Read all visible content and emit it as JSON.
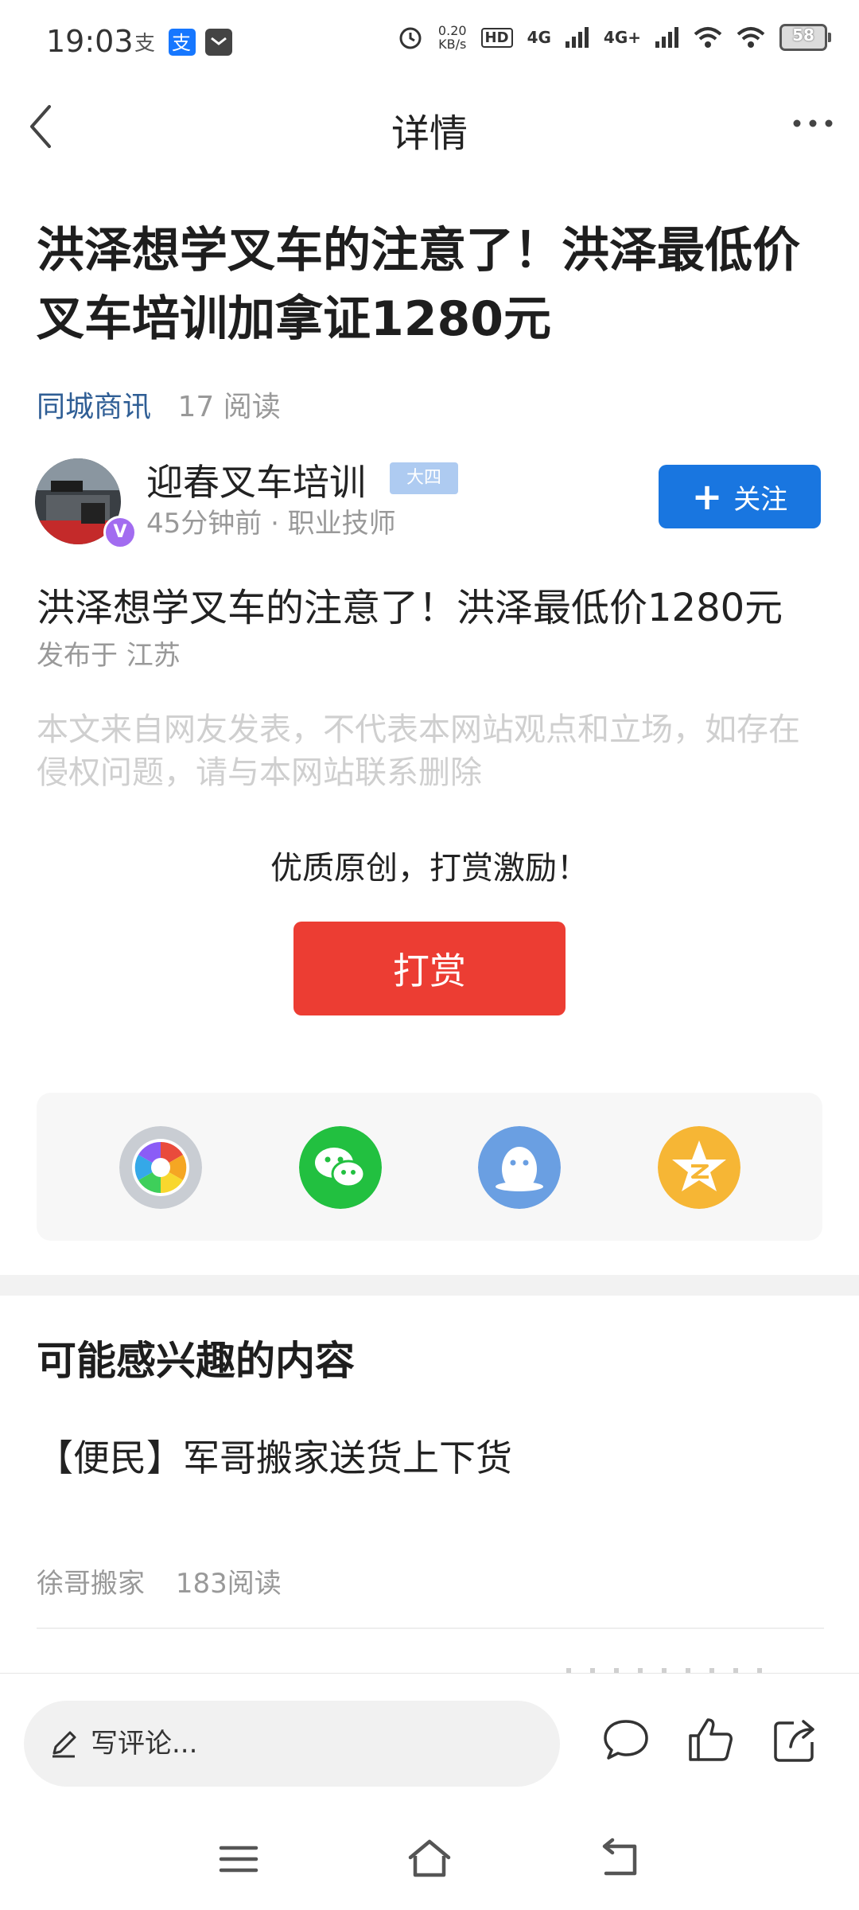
{
  "status_bar": {
    "time": "19:03",
    "net_speed_value": "0.20",
    "net_speed_unit": "KB/s",
    "hd_label": "HD",
    "signal1": "4G",
    "signal2": "4G+",
    "battery": "58",
    "icons": [
      "alipay-small-icon",
      "alipay-app-icon",
      "message-icon",
      "alarm-icon",
      "hd-icon",
      "signal-icon",
      "signal-icon",
      "wifi-icon",
      "wifi-icon",
      "battery-icon"
    ]
  },
  "nav": {
    "title": "详情"
  },
  "article": {
    "headline": "洪泽想学叉车的注意了！洪泽最低价叉车培训加拿证1280元",
    "source": "同城商讯",
    "reads": "17 阅读",
    "author": {
      "name": "迎春叉车培训",
      "level": "大四",
      "time_and_role": "45分钟前 · 职业技师",
      "verified_mark": "V"
    },
    "follow_label": "关注",
    "body_title": "洪泽想学叉车的注意了！洪泽最低价1280元",
    "location": "发布于 江苏",
    "disclaimer": "本文来自网友发表，不代表本网站观点和立场，如存在侵权问题，请与本网站联系删除"
  },
  "reward": {
    "text": "优质原创，打赏激励！",
    "button_label": "打赏"
  },
  "share": [
    {
      "name": "moments",
      "color": "#c9cdd3"
    },
    {
      "name": "wechat",
      "color": "#22c040"
    },
    {
      "name": "qq",
      "color": "#6a9fe2"
    },
    {
      "name": "qzone",
      "color": "#f6b635"
    }
  ],
  "recommend": {
    "heading": "可能感兴趣的内容",
    "items": [
      {
        "title": "【便民】军哥搬家送货上下货",
        "author": "徐哥搬家",
        "reads": "183阅读"
      }
    ]
  },
  "comment_bar": {
    "placeholder": "写评论..."
  },
  "colors": {
    "accent_blue": "#1976e0",
    "reward_red": "#ec3d33",
    "source_blue": "#2f5e95"
  }
}
